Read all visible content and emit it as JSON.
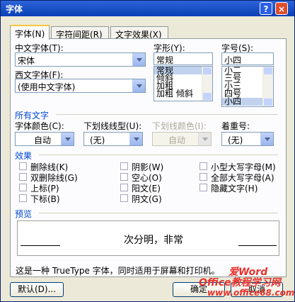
{
  "window": {
    "title": "字体",
    "help": "?",
    "close": "×"
  },
  "tabs": [
    "字体(N)",
    "字符间距(R)",
    "文字效果(X)"
  ],
  "font": {
    "cn_label": "中文字体(T):",
    "cn_value": "宋体",
    "en_label": "西文字体(F):",
    "en_value": "(使用中文字体)",
    "style_label": "字形(Y):",
    "style_value": "常规",
    "style_items": [
      "常规",
      "倾斜",
      "加粗",
      "加粗 倾斜"
    ],
    "size_label": "字号(S):",
    "size_value": "小四",
    "size_items": [
      "小二",
      "三号",
      "小三",
      "四号",
      "小四"
    ]
  },
  "all_text": {
    "group": "所有文字",
    "color_label": "字体颜色(C):",
    "color_value": "自动",
    "underline_label": "下划线线型(U):",
    "underline_value": "(无)",
    "underline_color_label": "下划线颜色(I):",
    "underline_color_value": "自动",
    "emphasis_label": "着重号:",
    "emphasis_value": "(无)"
  },
  "effects": {
    "group": "效果",
    "items": [
      "删除线(K)",
      "双删除线(G)",
      "上标(P)",
      "下标(B)",
      "阴影(W)",
      "空心(O)",
      "阳文(E)",
      "阴文(G)",
      "小型大写字母(M)",
      "全部大写字母(A)",
      "隐藏文字(H)"
    ]
  },
  "preview": {
    "group": "预览",
    "text": "次分明，非常"
  },
  "note": "这是一种 TrueType 字体，同时适用于屏幕和打印机。",
  "buttons": {
    "default": "默认(D)...",
    "ok": "确定",
    "cancel": "取消"
  },
  "watermark": {
    "line1": "Office教程学习网",
    "line2": "www.office68.com",
    "brand": "爱Word"
  }
}
